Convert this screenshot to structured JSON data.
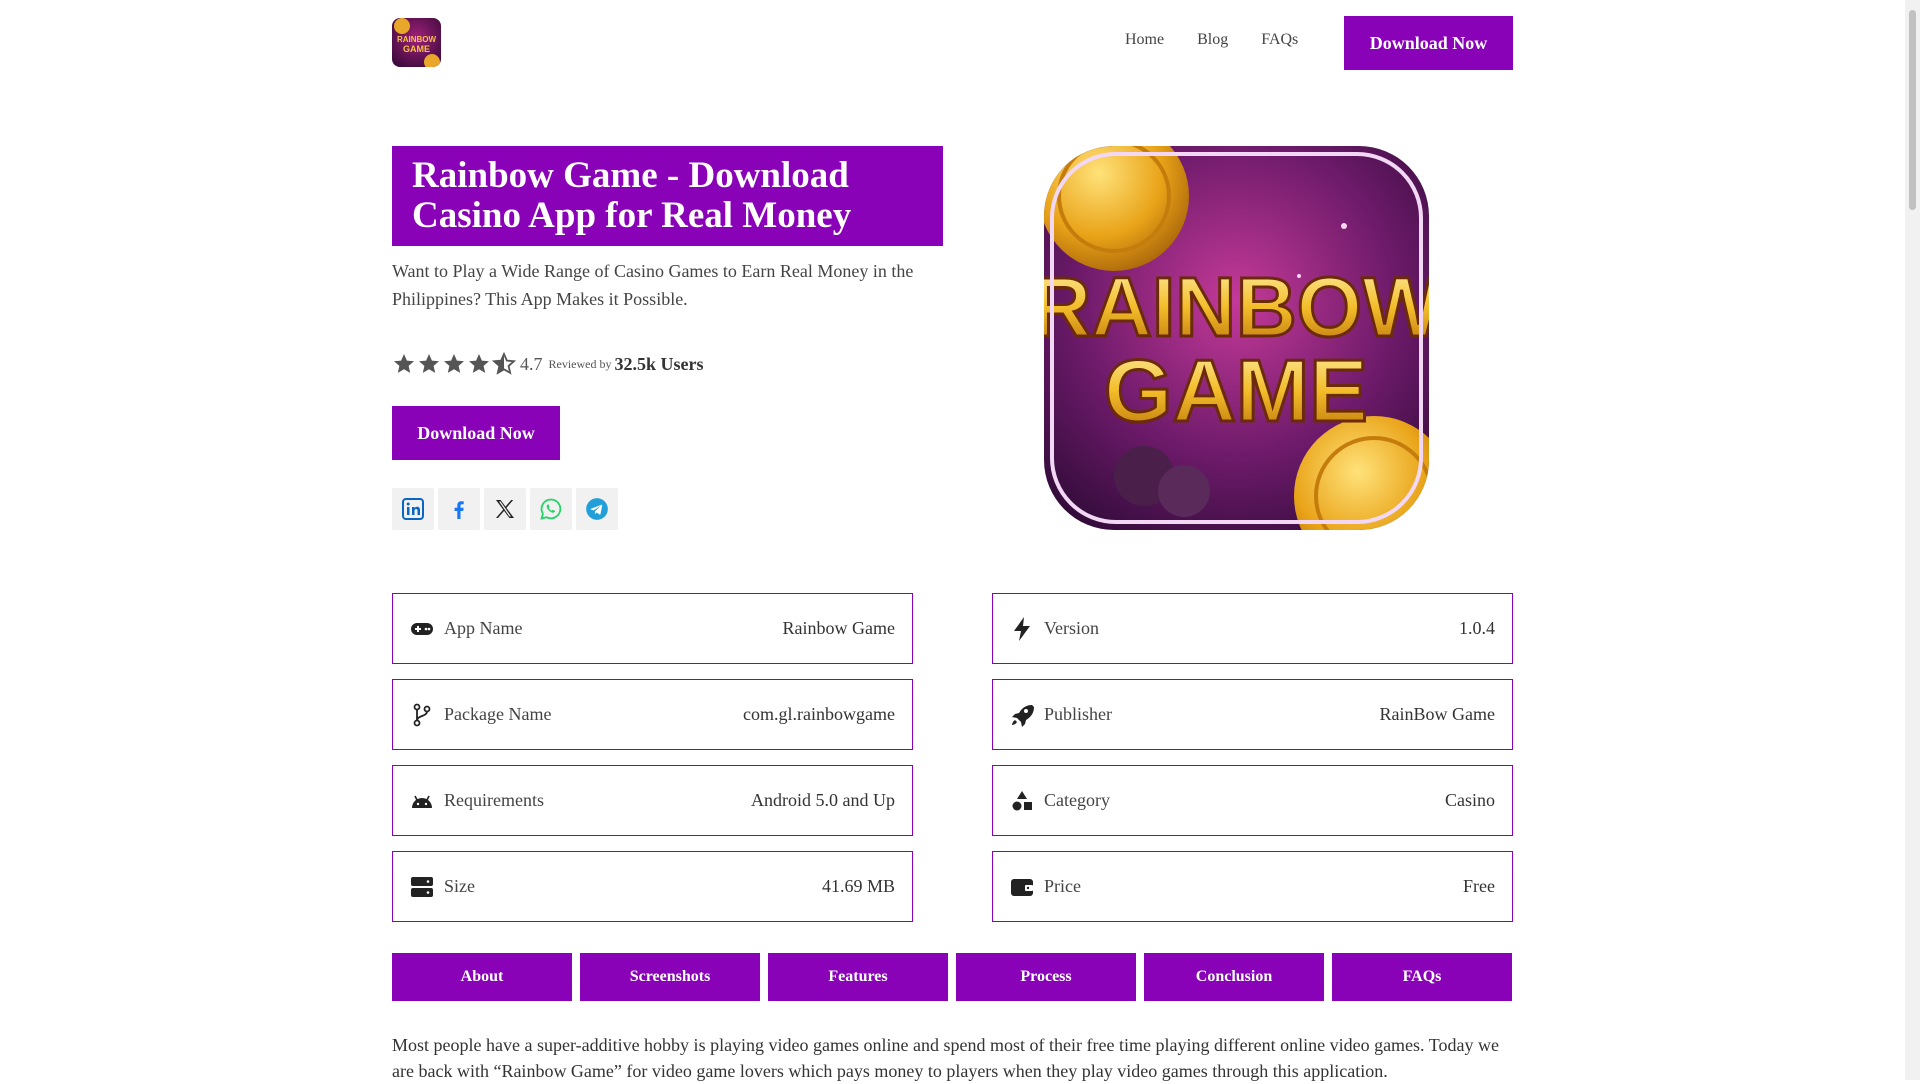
{
  "header": {
    "logo_text": "RAINBOW GAME",
    "nav": [
      "Home",
      "Blog",
      "FAQs"
    ],
    "download_label": "Download Now"
  },
  "hero": {
    "title": "Rainbow Game - Download Casino App for Real Money",
    "subtitle": "Want to Play a Wide Range of Casino Games to Earn Real Money in the Philippines? This App Makes it Possible.",
    "rating": "4.7",
    "rating_value": 4.5,
    "reviewed_by": "Reviewed by",
    "users": "32.5k Users",
    "download_label": "Download Now",
    "art_line1": "RAINBOW",
    "art_line2": "GAME"
  },
  "social": [
    "linkedin-icon",
    "facebook-icon",
    "x-icon",
    "whatsapp-icon",
    "telegram-icon"
  ],
  "info": {
    "app_name": {
      "label": "App Name",
      "value": "Rainbow Game",
      "icon": "gamepad-icon"
    },
    "version": {
      "label": "Version",
      "value": "1.0.4",
      "icon": "bolt-icon"
    },
    "package": {
      "label": "Package Name",
      "value": "com.gl.rainbowgame",
      "icon": "branch-icon"
    },
    "publisher": {
      "label": "Publisher",
      "value": "RainBow Game",
      "icon": "rocket-icon"
    },
    "requirements": {
      "label": "Requirements",
      "value": "Android 5.0 and Up",
      "icon": "android-icon"
    },
    "category": {
      "label": "Category",
      "value": "Casino",
      "icon": "shapes-icon"
    },
    "size": {
      "label": "Size",
      "value": "41.69 MB",
      "icon": "server-icon"
    },
    "price": {
      "label": "Price",
      "value": "Free",
      "icon": "wallet-icon"
    }
  },
  "tabs": [
    "About",
    "Screenshots",
    "Features",
    "Process",
    "Conclusion",
    "FAQs"
  ],
  "intro": "Most people have a super-additive hobby is playing video games online and spend most of their free time playing different online video games. Today we are back with “Rainbow Game” for video game lovers which pays money to players when they play video games through this application.",
  "colors": {
    "accent": "#8a02b8"
  }
}
